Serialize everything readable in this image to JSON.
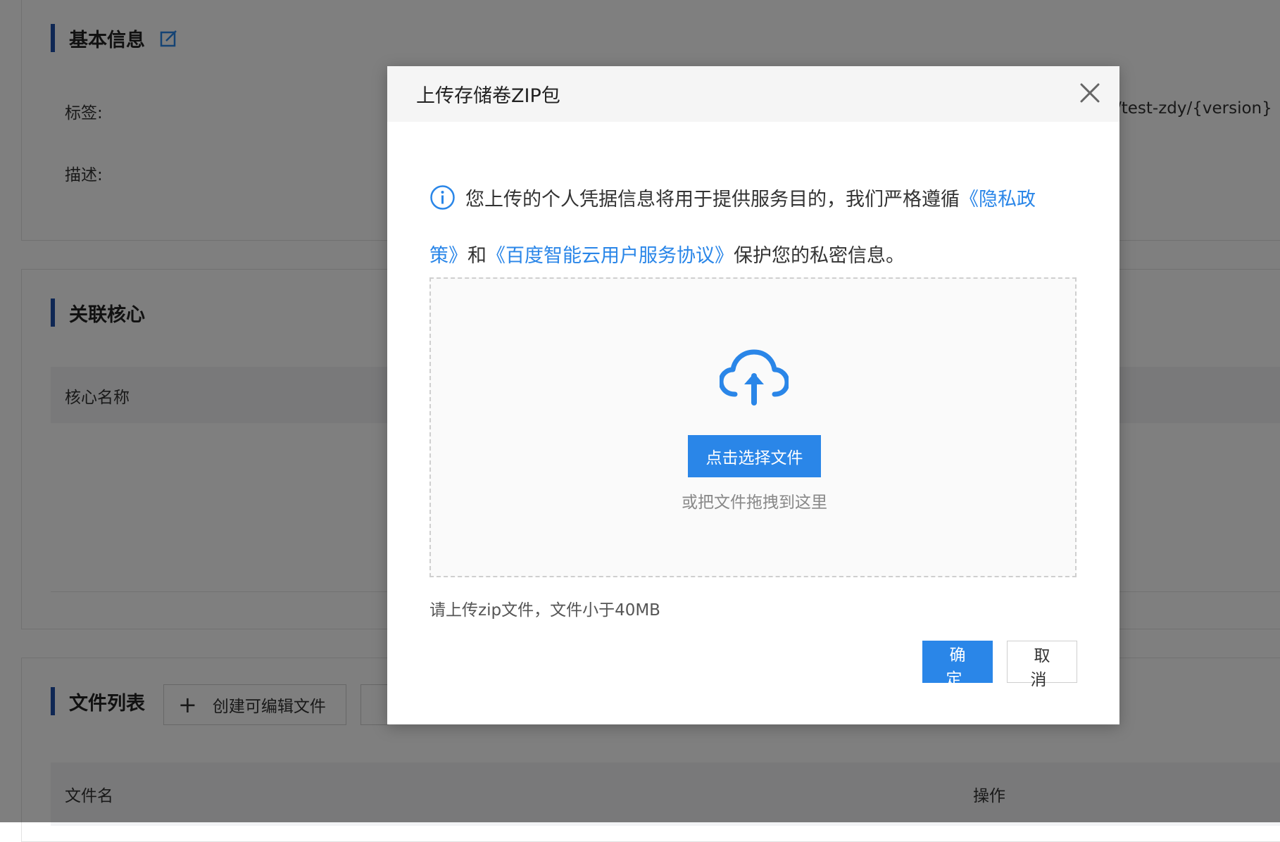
{
  "background": {
    "section1": {
      "title": "基本信息",
      "tag_label": "标签:",
      "desc_label": "描述:",
      "right_text": "/test-zdy/{version}"
    },
    "section2": {
      "title": "关联核心",
      "col_core_name": "核心名称"
    },
    "section3": {
      "title": "文件列表",
      "create_button": "创建可编辑文件",
      "col_filename": "文件名",
      "col_actions": "操作"
    }
  },
  "modal": {
    "title": "上传存储卷ZIP包",
    "notice": {
      "text_before": "您上传的个人凭据信息将用于提供服务目的，我们严格遵循",
      "link_privacy": "《隐私政策》",
      "text_and": "和",
      "link_agreement": "《百度智能云用户服务协议》",
      "text_after": "保护您的私密信息。"
    },
    "select_button": "点击选择文件",
    "drag_hint": "或把文件拖拽到这里",
    "upload_hint": "请上传zip文件，文件小于40MB",
    "ok_button": "确 定",
    "cancel_button": "取 消"
  },
  "colors": {
    "accent": "#2a86e8",
    "section_bar": "#1f4fa8",
    "overlay": "rgba(0,0,0,0.5)"
  },
  "icons": [
    "edit-icon",
    "close-icon",
    "info-icon",
    "cloud-upload-icon",
    "plus-icon"
  ]
}
